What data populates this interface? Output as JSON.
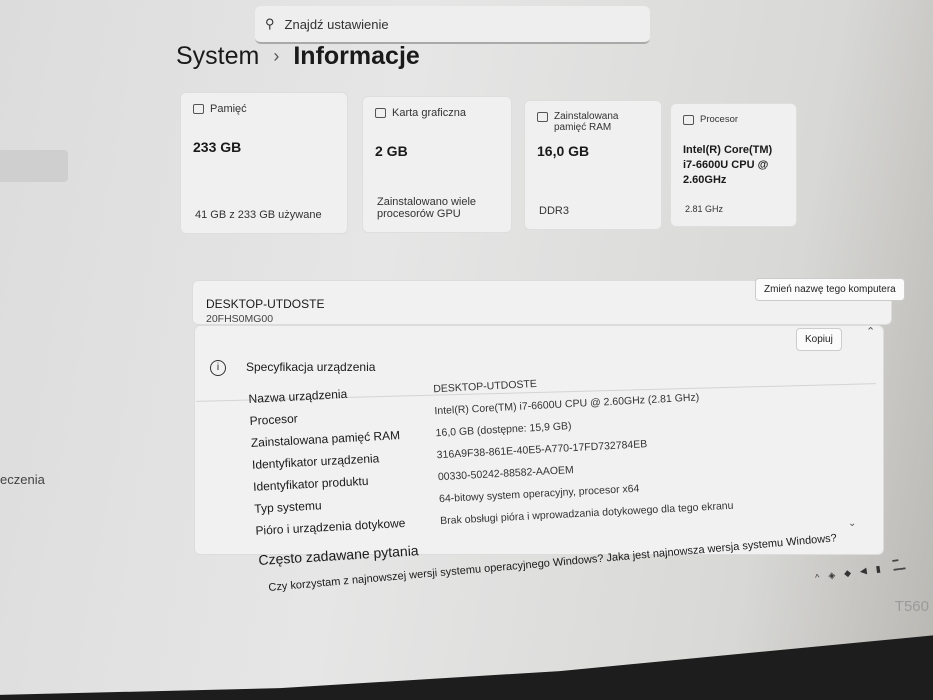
{
  "search": {
    "placeholder": "Znajdź ustawienie"
  },
  "breadcrumb": {
    "parent": "System",
    "current": "Informacje"
  },
  "sidebar": {
    "partial_item": "eczenia"
  },
  "cards": [
    {
      "label": "Pamięć",
      "value": "233 GB",
      "sub": "41 GB z 233 GB używane",
      "icon": "drive-icon"
    },
    {
      "label": "Karta graficzna",
      "value": "2 GB",
      "sub": "Zainstalowano wiele procesorów GPU",
      "icon": "gpu-icon"
    },
    {
      "label": "Zainstalowana pamięć RAM",
      "value": "16,0 GB",
      "sub": "DDR3",
      "icon": "ram-icon"
    },
    {
      "label": "Procesor",
      "value": "Intel(R) Core(TM) i7-6600U CPU @ 2.60GHz",
      "sub": "2.81 GHz",
      "icon": "cpu-icon"
    }
  ],
  "device": {
    "name": "DESKTOP-UTDOSTE",
    "model": "20FHS0MG00",
    "rename_button": "Zmień nazwę tego komputera"
  },
  "spec": {
    "title": "Specyfikacja urządzenia",
    "copy_button": "Kopiuj",
    "rows": [
      {
        "key": "Nazwa urządzenia",
        "value": "DESKTOP-UTDOSTE"
      },
      {
        "key": "Procesor",
        "value": "Intel(R) Core(TM) i7-6600U CPU @ 2.60GHz (2.81 GHz)"
      },
      {
        "key": "Zainstalowana pamięć RAM",
        "value": "16,0 GB (dostępne: 15,9 GB)"
      },
      {
        "key": "Identyfikator urządzenia",
        "value": "316A9F38-861E-40E5-A770-17FD732784EB"
      },
      {
        "key": "Identyfikator produktu",
        "value": "00330-50242-88582-AAOEM"
      },
      {
        "key": "Typ systemu",
        "value": "64-bitowy system operacyjny, procesor x64"
      },
      {
        "key": "Pióro i urządzenia dotykowe",
        "value": "Brak obsługi pióra i wprowadzania dotykowego dla tego ekranu"
      }
    ]
  },
  "faq": {
    "title": "Często zadawane pytania",
    "question": "Czy korzystam z najnowszej wersji systemu operacyjnego Windows? Jaka jest najnowsza wersja systemu Windows?"
  },
  "laptop": {
    "brand": "T560"
  }
}
